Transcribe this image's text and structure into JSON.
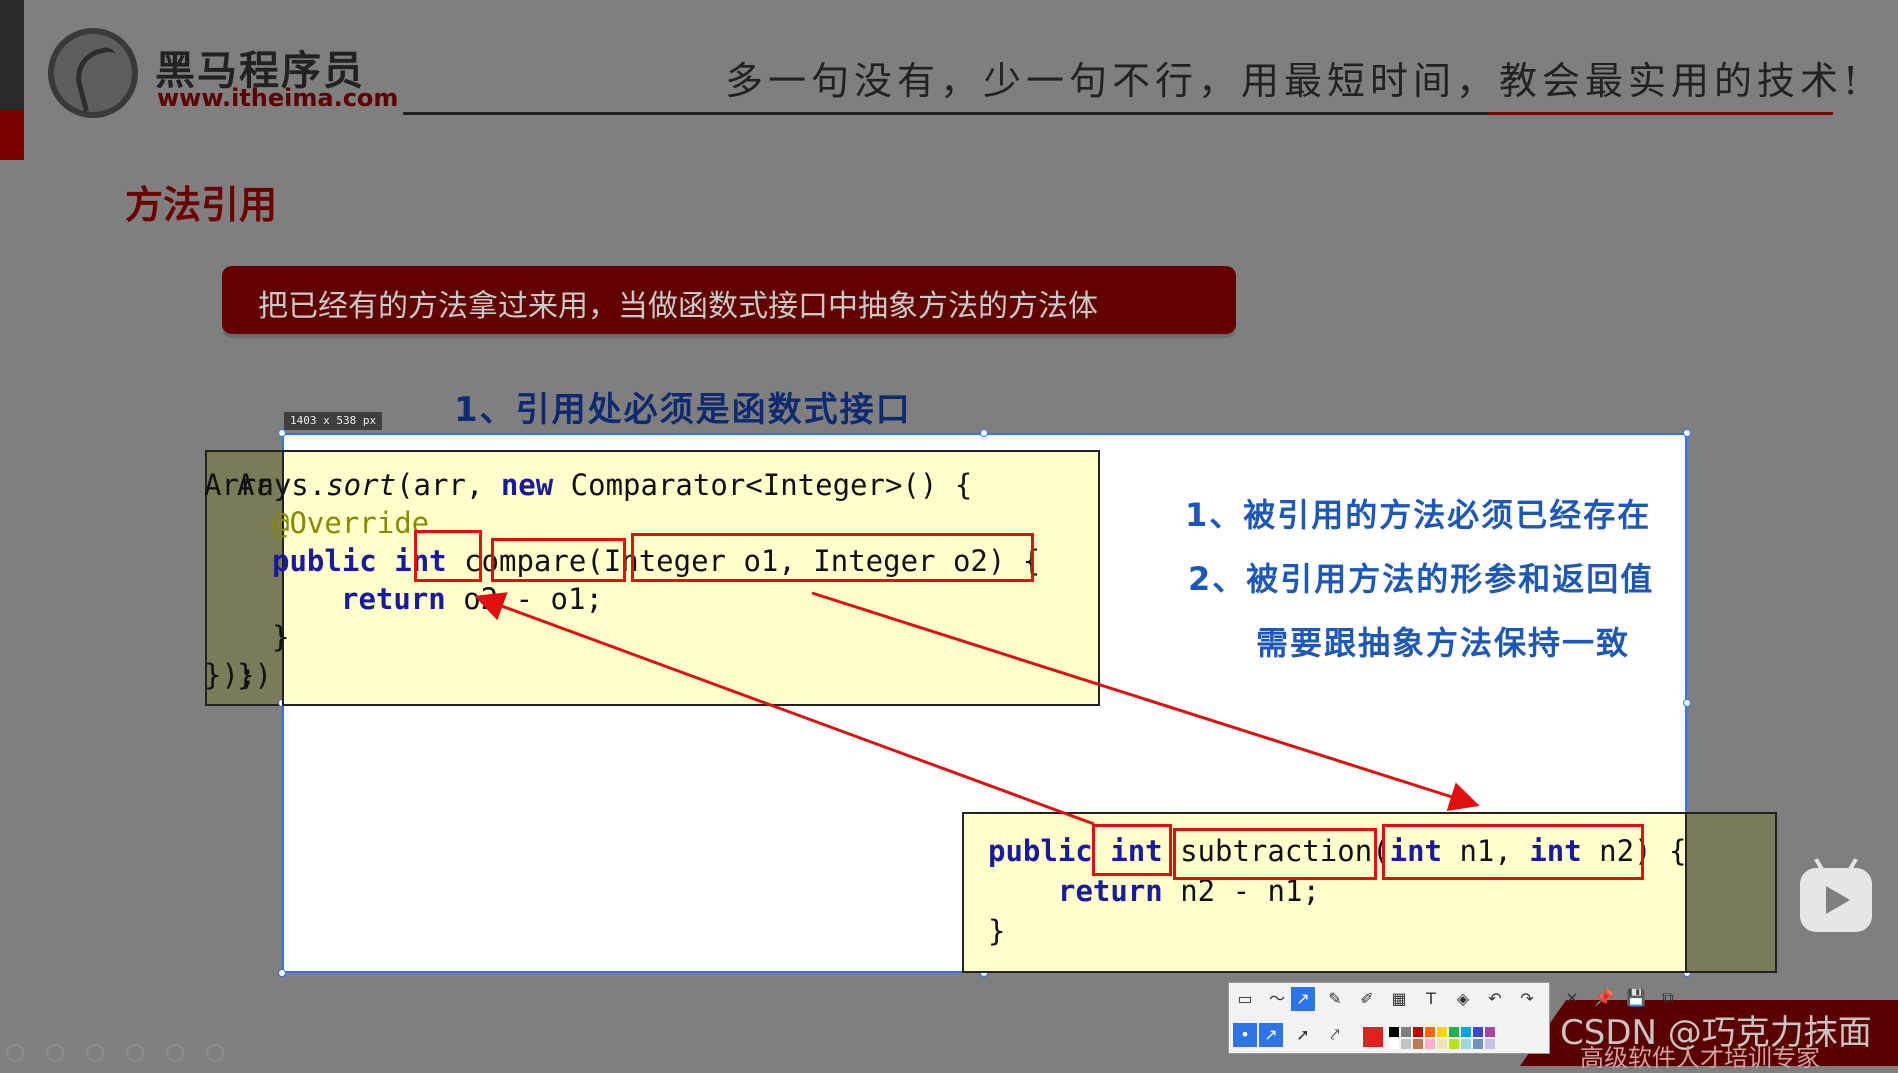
{
  "header": {
    "logo_cn": "黑马程序员",
    "logo_url": "www.itheima.com",
    "slogan": "多一句没有，少一句不行，用最短时间，教会最实用的技术!"
  },
  "slide": {
    "section_title": "方法引用",
    "banner_text": "把已经有的方法拿过来用，当做函数式接口中抽象方法的方法体",
    "note_top": "1、引用处必须是函数式接口",
    "note_right": [
      "1、被引用的方法必须已经存在",
      "2、被引用方法的形参和返回值",
      "需要跟抽象方法保持一致"
    ]
  },
  "code1": {
    "line1_a": "Arrays.",
    "line1_b": "sort",
    "line1_c": "(arr, ",
    "line1_d": "new",
    "line1_e": " Comparator<Integer>() {",
    "line2": "@Override",
    "line3_a": "public",
    "line3_b": "int",
    "line3_c": "compare",
    "line3_d": "(Integer o1, Integer o2) {",
    "line4_a": "return",
    "line4_b": " o2 - o1;",
    "line5": "}",
    "line6": "});"
  },
  "code2": {
    "line1_a": "public",
    "line1_b": "int",
    "line1_c": "subtraction",
    "line1_d": "(",
    "line1_e": "int",
    "line1_f": " n1, ",
    "line1_g": "int",
    "line1_h": " n2) {",
    "line2_a": "return",
    "line2_b": " n2 - n1;",
    "line3": "}"
  },
  "overlay": {
    "size_label": "1403 x 538  px",
    "border_color": "#2e74e6"
  },
  "toolbar": {
    "row1": [
      "rect-icon",
      "curve-icon",
      "arrow-icon",
      "pencil-icon",
      "marker-icon",
      "mosaic-icon",
      "T",
      "eraser-icon",
      "undo-icon",
      "redo-icon",
      "×",
      "pin-icon",
      "save-icon",
      "copy-icon"
    ],
    "text_tool": "T",
    "close_tool": "×",
    "colors": [
      "#e02020",
      "#000000",
      "#7f7f7f",
      "#c00000",
      "#ff6a00",
      "#ffd400",
      "#22b14c",
      "#00a2e8",
      "#3f48cc",
      "#a349a4",
      "#ffffff",
      "#b97a57"
    ]
  },
  "watermark": {
    "csdn": "CSDN @巧克力抹面",
    "line2": "高级软件人才培训专家"
  },
  "colors": {
    "dark_red": "#620000",
    "highlight_red": "#e01010",
    "code_bg": "#ffffcc",
    "note_blue": "#1d57b8"
  }
}
